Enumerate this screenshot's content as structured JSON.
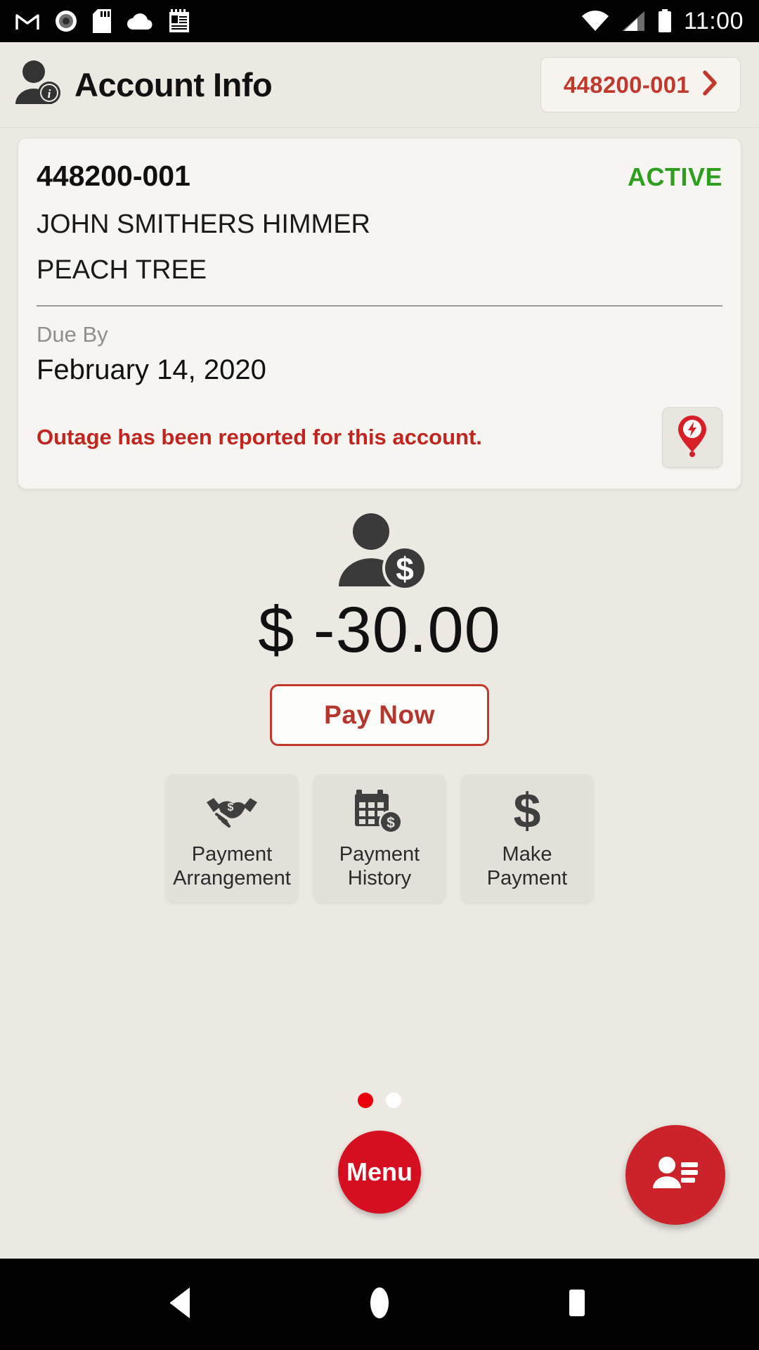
{
  "status_bar": {
    "time": "11:00",
    "left_icons": [
      "gmail-icon",
      "record-icon",
      "sd-card-icon",
      "cloud-icon",
      "notepad-icon"
    ],
    "right_icons": [
      "wifi-icon",
      "cellular-signal-icon",
      "battery-icon"
    ]
  },
  "header": {
    "title": "Account Info",
    "avatar_icon": "person-info-icon",
    "account_chip": {
      "label": "448200-001",
      "chevron_icon": "chevron-right-icon"
    }
  },
  "account_card": {
    "account_number": "448200-001",
    "status": "ACTIVE",
    "status_color": "#2e9e1f",
    "customer_name": "JOHN SMITHERS HIMMER",
    "address": "PEACH TREE",
    "due_by_label": "Due By",
    "due_by_date": "February 14, 2020",
    "outage_message": "Outage has been reported for this account.",
    "outage_color": "#c0261f",
    "outage_button_icon": "outage-pin-icon"
  },
  "balance": {
    "icon": "person-dollar-icon",
    "amount": "$ -30.00",
    "pay_now_label": "Pay Now",
    "accent_color": "#c0392b"
  },
  "tiles": [
    {
      "icon": "handshake-dollar-icon",
      "line1": "Payment",
      "line2": "Arrangement"
    },
    {
      "icon": "calendar-dollar-icon",
      "line1": "Payment",
      "line2": "History"
    },
    {
      "icon": "dollar-sign-icon",
      "line1": "Make",
      "line2": "Payment"
    }
  ],
  "pagination": {
    "total": 2,
    "active_index": 0,
    "active_color": "#e8000d",
    "inactive_color": "#ffffff"
  },
  "fabs": {
    "menu_label": "Menu",
    "menu_color": "#d50f1f",
    "contact_icon": "contact-card-icon",
    "contact_color": "#cc2229"
  },
  "nav_bar": {
    "back_icon": "back-triangle-icon",
    "home_icon": "home-circle-icon",
    "recents_icon": "recents-square-icon"
  }
}
